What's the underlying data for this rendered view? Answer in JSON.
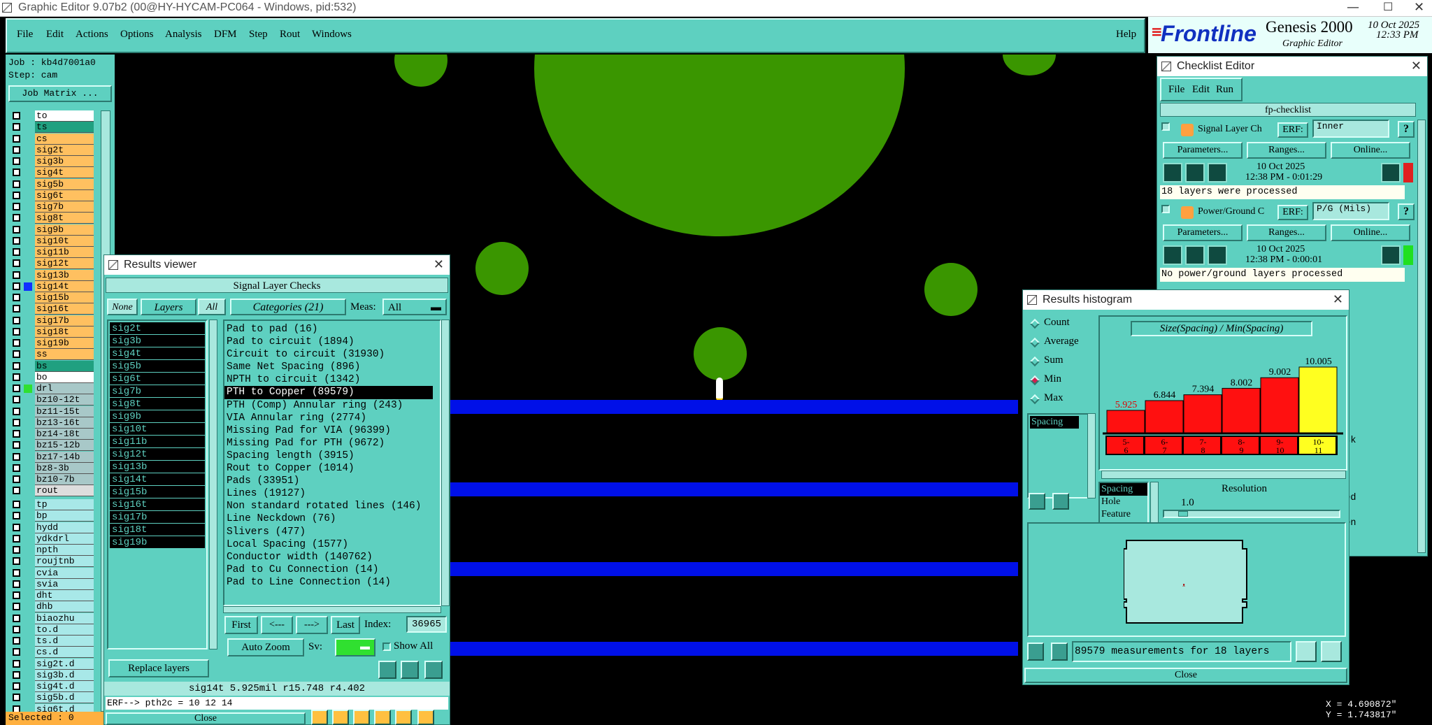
{
  "title_bar": {
    "text": "Graphic Editor 9.07b2 (00@HY-HYCAM-PC064 - Windows, pid:532)"
  },
  "menu": {
    "items": [
      "File",
      "Edit",
      "Actions",
      "Options",
      "Analysis",
      "DFM",
      "Step",
      "Rout",
      "Windows"
    ],
    "help": "Help"
  },
  "brand": {
    "logo": "Frontline",
    "product": "Genesis 2000",
    "subtitle": "Graphic Editor",
    "date": "10 Oct 2025",
    "time": "12:33 PM"
  },
  "job": {
    "job": "Job : kb4d7001a0",
    "step": "Step: cam",
    "matrix_btn": "Job Matrix ..."
  },
  "layers": {
    "group1": [
      {
        "name": "to",
        "color": "#ffffff"
      },
      {
        "name": "ts",
        "color": "#20a080"
      },
      {
        "name": "cs",
        "color": "#ffc060"
      },
      {
        "name": "sig2t",
        "color": "#ffc060"
      },
      {
        "name": "sig3b",
        "color": "#ffc060"
      },
      {
        "name": "sig4t",
        "color": "#ffc060"
      },
      {
        "name": "sig5b",
        "color": "#ffc060"
      },
      {
        "name": "sig6t",
        "color": "#ffc060"
      },
      {
        "name": "sig7b",
        "color": "#ffc060"
      },
      {
        "name": "sig8t",
        "color": "#ffc060"
      },
      {
        "name": "sig9b",
        "color": "#ffc060"
      },
      {
        "name": "sig10t",
        "color": "#ffc060"
      },
      {
        "name": "sig11b",
        "color": "#ffc060"
      },
      {
        "name": "sig12t",
        "color": "#ffc060"
      },
      {
        "name": "sig13b",
        "color": "#ffc060"
      },
      {
        "name": "sig14t",
        "color": "#ffc060"
      },
      {
        "name": "sig15b",
        "color": "#ffc060"
      },
      {
        "name": "sig16t",
        "color": "#ffc060"
      },
      {
        "name": "sig17b",
        "color": "#ffc060"
      },
      {
        "name": "sig18t",
        "color": "#ffc060"
      },
      {
        "name": "sig19b",
        "color": "#ffc060"
      },
      {
        "name": "ss",
        "color": "#ffc060"
      },
      {
        "name": "bs",
        "color": "#20a080"
      },
      {
        "name": "bo",
        "color": "#ffffff"
      }
    ],
    "group2": [
      {
        "name": "drl",
        "color": "#a8c8c8"
      },
      {
        "name": "bz10-12t",
        "color": "#a8c8c8"
      },
      {
        "name": "bz11-15t",
        "color": "#a8c8c8"
      },
      {
        "name": "bz13-16t",
        "color": "#a8c8c8"
      },
      {
        "name": "bz14-18t",
        "color": "#a8c8c8"
      },
      {
        "name": "bz15-12b",
        "color": "#a8c8c8"
      },
      {
        "name": "bz17-14b",
        "color": "#a8c8c8"
      },
      {
        "name": "bz8-3b",
        "color": "#a8c8c8"
      },
      {
        "name": "bz10-7b",
        "color": "#a8c8c8"
      },
      {
        "name": "rout",
        "color": "#dddddd"
      }
    ],
    "group3": [
      {
        "name": "tp",
        "color": "#a8e8e8"
      },
      {
        "name": "bp",
        "color": "#a8e8e8"
      },
      {
        "name": "hydd",
        "color": "#a8e8e8"
      },
      {
        "name": "ydkdrl",
        "color": "#a8e8e8"
      },
      {
        "name": "npth",
        "color": "#a8e8e8"
      },
      {
        "name": "roujtnb",
        "color": "#a8e8e8"
      },
      {
        "name": "cvia",
        "color": "#a8e8e8"
      },
      {
        "name": "svia",
        "color": "#a8e8e8"
      },
      {
        "name": "dht",
        "color": "#a8e8e8"
      },
      {
        "name": "dhb",
        "color": "#a8e8e8"
      },
      {
        "name": "biaozhu",
        "color": "#a8e8e8"
      },
      {
        "name": "to.d",
        "color": "#a8e8e8"
      },
      {
        "name": "ts.d",
        "color": "#a8e8e8"
      },
      {
        "name": "cs.d",
        "color": "#a8e8e8"
      },
      {
        "name": "sig2t.d",
        "color": "#a8e8e8"
      },
      {
        "name": "sig3b.d",
        "color": "#a8e8e8"
      },
      {
        "name": "sig4t.d",
        "color": "#a8e8e8"
      },
      {
        "name": "sig5b.d",
        "color": "#a8e8e8"
      },
      {
        "name": "sig6t.d",
        "color": "#a8e8e8"
      }
    ],
    "selected": "Selected : 0"
  },
  "results_viewer": {
    "title": "Results viewer",
    "header": "Signal Layer Checks",
    "none_btn": "None",
    "layers_btn": "Layers",
    "all_btn": "All",
    "categories_btn": "Categories (21)",
    "meas_label": "Meas:",
    "meas_value": "All",
    "layers": [
      "sig2t",
      "sig3b",
      "sig4t",
      "sig5b",
      "sig6t",
      "sig7b",
      "sig8t",
      "sig9b",
      "sig10t",
      "sig11b",
      "sig12t",
      "sig13b",
      "sig14t",
      "sig15b",
      "sig16t",
      "sig17b",
      "sig18t",
      "sig19b"
    ],
    "categories": [
      "Pad to pad (16)",
      "Pad to circuit (1894)",
      "Circuit to circuit (31930)",
      "Same Net Spacing (896)",
      "NPTH to circuit (1342)",
      "PTH to Copper (89579)",
      "PTH (Comp) Annular ring (243)",
      "VIA Annular ring (2774)",
      "Missing Pad for VIA (96399)",
      "Missing Pad for PTH (9672)",
      "Spacing length (3915)",
      "Rout to Copper (1014)",
      "Pads (33951)",
      "Lines (19127)",
      "Non standard rotated lines (146)",
      "Line Neckdown (76)",
      "Slivers (477)",
      "Local Spacing (1577)",
      "Conductor width (140762)",
      "Pad to Cu Connection (14)",
      "Pad to Line Connection (14)"
    ],
    "selected_category": "PTH to Copper (89579)",
    "nav": {
      "first": "First",
      "prev": "<---",
      "next": "--->",
      "last": "Last",
      "index_label": "Index:",
      "index_value": "36965"
    },
    "replace_btn": "Replace layers",
    "zoom_btn": "Auto Zoom",
    "sv_label": "Sv:",
    "show_all": "Show All",
    "status": "sig14t 5.925mil  r15.748  r4.402",
    "erf": "ERF--> pth2c = 10 12 14",
    "close": "Close"
  },
  "checklist": {
    "title": "Checklist Editor",
    "menu": [
      "File",
      "Edit",
      "Run"
    ],
    "name": "fp-checklist",
    "erf_label": "ERF:",
    "params_btn": "Parameters...",
    "ranges_btn": "Ranges...",
    "online_btn": "Online...",
    "checks": [
      {
        "name": "Signal Layer Ch",
        "erf": "Inner",
        "date": "10 Oct 2025",
        "time": "12:38 PM - 0:01:29",
        "msg": "18 layers were processed",
        "status_color": "#e02020"
      },
      {
        "name": "Power/Ground C",
        "erf": "P/G (Mils)",
        "date": "10 Oct 2025",
        "time": "12:38 PM - 0:00:01",
        "msg": "No power/ground layers processed",
        "status_color": "#20e020"
      }
    ],
    "partial": [
      "rmask",
      "essed",
      "creen"
    ]
  },
  "histogram": {
    "title": "Results histogram",
    "options": [
      "Count",
      "Average",
      "Sum",
      "Min",
      "Max"
    ],
    "selected_option": "Min",
    "list_item": "Spacing",
    "chart_title": "Size(Spacing) / Min(Spacing)",
    "chart_data": {
      "type": "bar",
      "categories": [
        "5-6",
        "6-7",
        "7-8",
        "8-9",
        "9-10",
        "10-11"
      ],
      "values": [
        5.925,
        6.844,
        7.394,
        8.002,
        9.002,
        10.005
      ],
      "labels": [
        "5.925",
        "6.844",
        "7.394",
        "8.002",
        "9.002",
        "10.005"
      ],
      "bar_colors": [
        "#ff1010",
        "#ff1010",
        "#ff1010",
        "#ff1010",
        "#ff1010",
        "#ffff20"
      ]
    },
    "cat_labels": [
      [
        "5-",
        "6"
      ],
      [
        "6-",
        "7"
      ],
      [
        "7-",
        "8"
      ],
      [
        "8-",
        "9"
      ],
      [
        "9-",
        "10"
      ],
      [
        "10-",
        "11"
      ]
    ],
    "attr_list": [
      "Spacing",
      "Hole",
      "Feature"
    ],
    "resolution_label": "Resolution",
    "resolution_value": "1.0",
    "status": "89579 measurements for 18 layers",
    "close": "Close"
  },
  "coords": {
    "x": "X = 4.690872\"",
    "y": "Y = 1.743817\""
  }
}
